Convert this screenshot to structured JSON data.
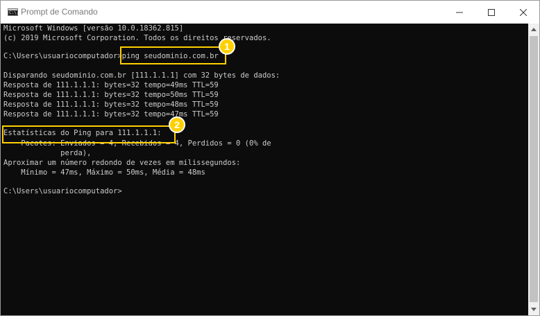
{
  "window": {
    "title": "Prompt de Comando",
    "app_icon": "console-icon",
    "app_icon_text": "C:\\.",
    "controls": [
      "minimize-icon",
      "maximize-icon",
      "close-icon"
    ]
  },
  "console": {
    "lines": [
      "Microsoft Windows [versão 10.0.18362.815]",
      "(c) 2019 Microsoft Corporation. Todos os direitos reservados.",
      "",
      "C:\\Users\\usuariocomputador>ping seudominio.com.br",
      "",
      "Disparando seudominio.com.br [111.1.1.1] com 32 bytes de dados:",
      "Resposta de 111.1.1.1: bytes=32 tempo=49ms TTL=59",
      "Resposta de 111.1.1.1: bytes=32 tempo=50ms TTL=59",
      "Resposta de 111.1.1.1: bytes=32 tempo=48ms TTL=59",
      "Resposta de 111.1.1.1: bytes=32 tempo=47ms TTL=59",
      "",
      "Estatísticas do Ping para 111.1.1.1:",
      "    Pacotes: Enviados = 4, Recebidos = 4, Perdidos = 0 (0% de",
      "             perda),",
      "Aproximar um número redondo de vezes em milissegundos:",
      "    Mínimo = 47ms, Máximo = 50ms, Média = 48ms",
      "",
      "C:\\Users\\usuariocomputador>"
    ]
  },
  "annotations": {
    "highlight_color": "#ffd000",
    "badges": [
      "1",
      "2"
    ]
  }
}
